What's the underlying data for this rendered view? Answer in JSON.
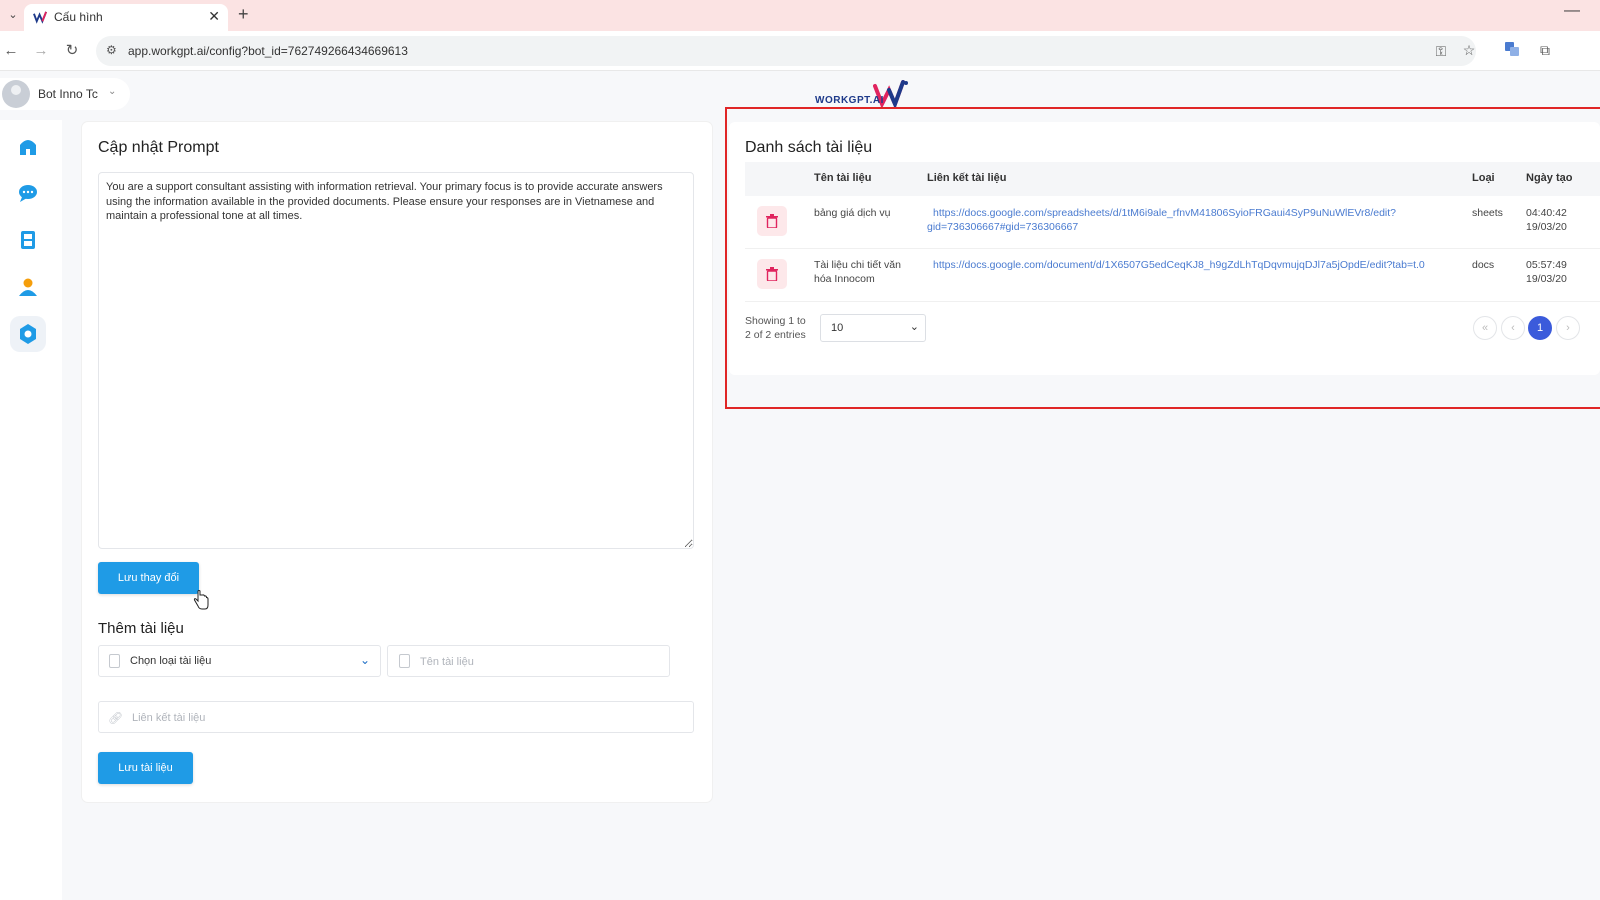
{
  "browser": {
    "tab_title": "Cấu hình",
    "url": "app.workgpt.ai/config?bot_id=762749266434669613"
  },
  "header": {
    "bot_name": "Bot Inno Tc",
    "brand": "WORKGPT.AI"
  },
  "sidebar": {
    "items": [
      {
        "icon": "home-icon",
        "active": false
      },
      {
        "icon": "chat-icon",
        "active": false
      },
      {
        "icon": "bot-icon",
        "active": false
      },
      {
        "icon": "user-icon",
        "active": false
      },
      {
        "icon": "settings-icon",
        "active": true
      }
    ]
  },
  "prompt": {
    "title": "Cập nhật Prompt",
    "text": "You are a support consultant assisting with information retrieval. Your primary focus is to provide accurate answers using the information available in the provided documents. Please ensure your responses are in Vietnamese and maintain a professional tone at all times.",
    "save_label": "Lưu thay đổi"
  },
  "add_doc": {
    "title": "Thêm tài liệu",
    "type_select": "Chọn loại tài liệu",
    "name_placeholder": "Tên tài liệu",
    "link_placeholder": "Liên kết tài liệu",
    "save_label": "Lưu tài liệu"
  },
  "doc_list": {
    "title": "Danh sách tài liệu",
    "columns": {
      "name": "Tên tài liệu",
      "link": "Liên kết tài liệu",
      "type": "Loại",
      "date": "Ngày tạo"
    },
    "rows": [
      {
        "name_l1": "bảng giá dịch vụ",
        "name_l2": "",
        "link_l1": "https://docs.google.com/spreadsheets/d/1tM6i9ale_rfnvM41806SyioFRGaui4SyP9uNuWlEVr8/edit?",
        "link_l2": "gid=736306667#gid=736306667",
        "type": "sheets",
        "time": "04:40:42",
        "date": "19/03/20"
      },
      {
        "name_l1": "Tài liệu chi tiết văn",
        "name_l2": "hóa Innocom",
        "link_l1": "https://docs.google.com/document/d/1X6507G5edCeqKJ8_h9gZdLhTqDqvmujqDJl7a5jOpdE/edit?tab=t.0",
        "link_l2": "",
        "type": "docs",
        "time": "05:57:49",
        "date": "19/03/20"
      }
    ],
    "showing_l1": "Showing 1 to",
    "showing_l2": "2 of 2 entries",
    "page_size": "10",
    "current_page": "1"
  },
  "colors": {
    "primary": "#1f9be6",
    "highlight": "#e02626",
    "page_active": "#3b5bdb"
  }
}
